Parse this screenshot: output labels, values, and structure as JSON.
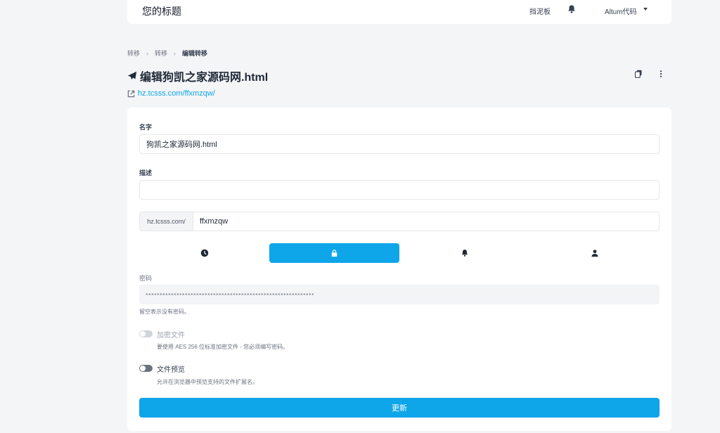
{
  "header": {
    "brand": "您的标题",
    "dashboard_label": "挡泥板",
    "user_label": "Altum代码"
  },
  "breadcrumb": {
    "items": [
      "转移",
      "转移"
    ],
    "current": "编辑转移"
  },
  "page": {
    "title": "编辑狗凯之家源码网.html",
    "link": "hz.tcsss.com/ffxmzqw/"
  },
  "form": {
    "name_label": "名字",
    "name_value": "狗凯之家源码网.html",
    "description_label": "描述",
    "description_value": "",
    "url_prefix": "hz.tcsss.com/",
    "url_value": "ffxmzqw",
    "tabs": [
      {
        "icon": "clock-icon",
        "active": false
      },
      {
        "icon": "lock-icon",
        "active": true
      },
      {
        "icon": "bell-icon",
        "active": false
      },
      {
        "icon": "user-icon",
        "active": false
      }
    ],
    "password_label": "密码",
    "password_value": "••••••••••••••••••••••••••••••••••••••••••••••••••••••••••••",
    "password_help": "留空表示没有密码。",
    "encrypt_label": "加密文件",
    "encrypt_help": "要使用 AES 256 位标准加密文件 - 您必须编写密码。",
    "preview_label": "文件预览",
    "preview_help": "允许在浏览器中预览支持的文件扩展名。",
    "submit_label": "更新"
  },
  "colors": {
    "accent": "#0ea5e9",
    "background": "#f4f5f7"
  }
}
